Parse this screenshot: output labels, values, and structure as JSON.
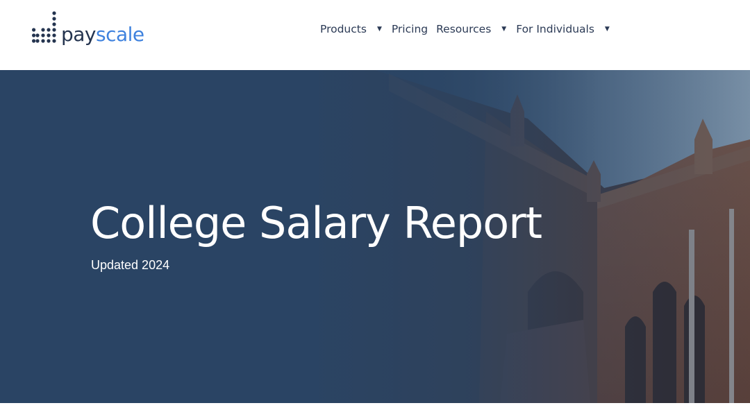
{
  "brand": {
    "name_part1": "pay",
    "name_part2": "scale",
    "colors": {
      "navy": "#24344f",
      "blue": "#3f82de"
    }
  },
  "nav": {
    "items": [
      {
        "label": "Products",
        "has_dropdown": true
      },
      {
        "label": "Pricing",
        "has_dropdown": false
      },
      {
        "label": "Resources",
        "has_dropdown": true
      },
      {
        "label": "For Individuals",
        "has_dropdown": true
      }
    ],
    "caret_icon": "caret-down-icon"
  },
  "hero": {
    "title": "College Salary Report",
    "subtitle": "Updated 2024",
    "overlay_color": "#2a4464",
    "background_image": "brick-gothic-college-building"
  }
}
